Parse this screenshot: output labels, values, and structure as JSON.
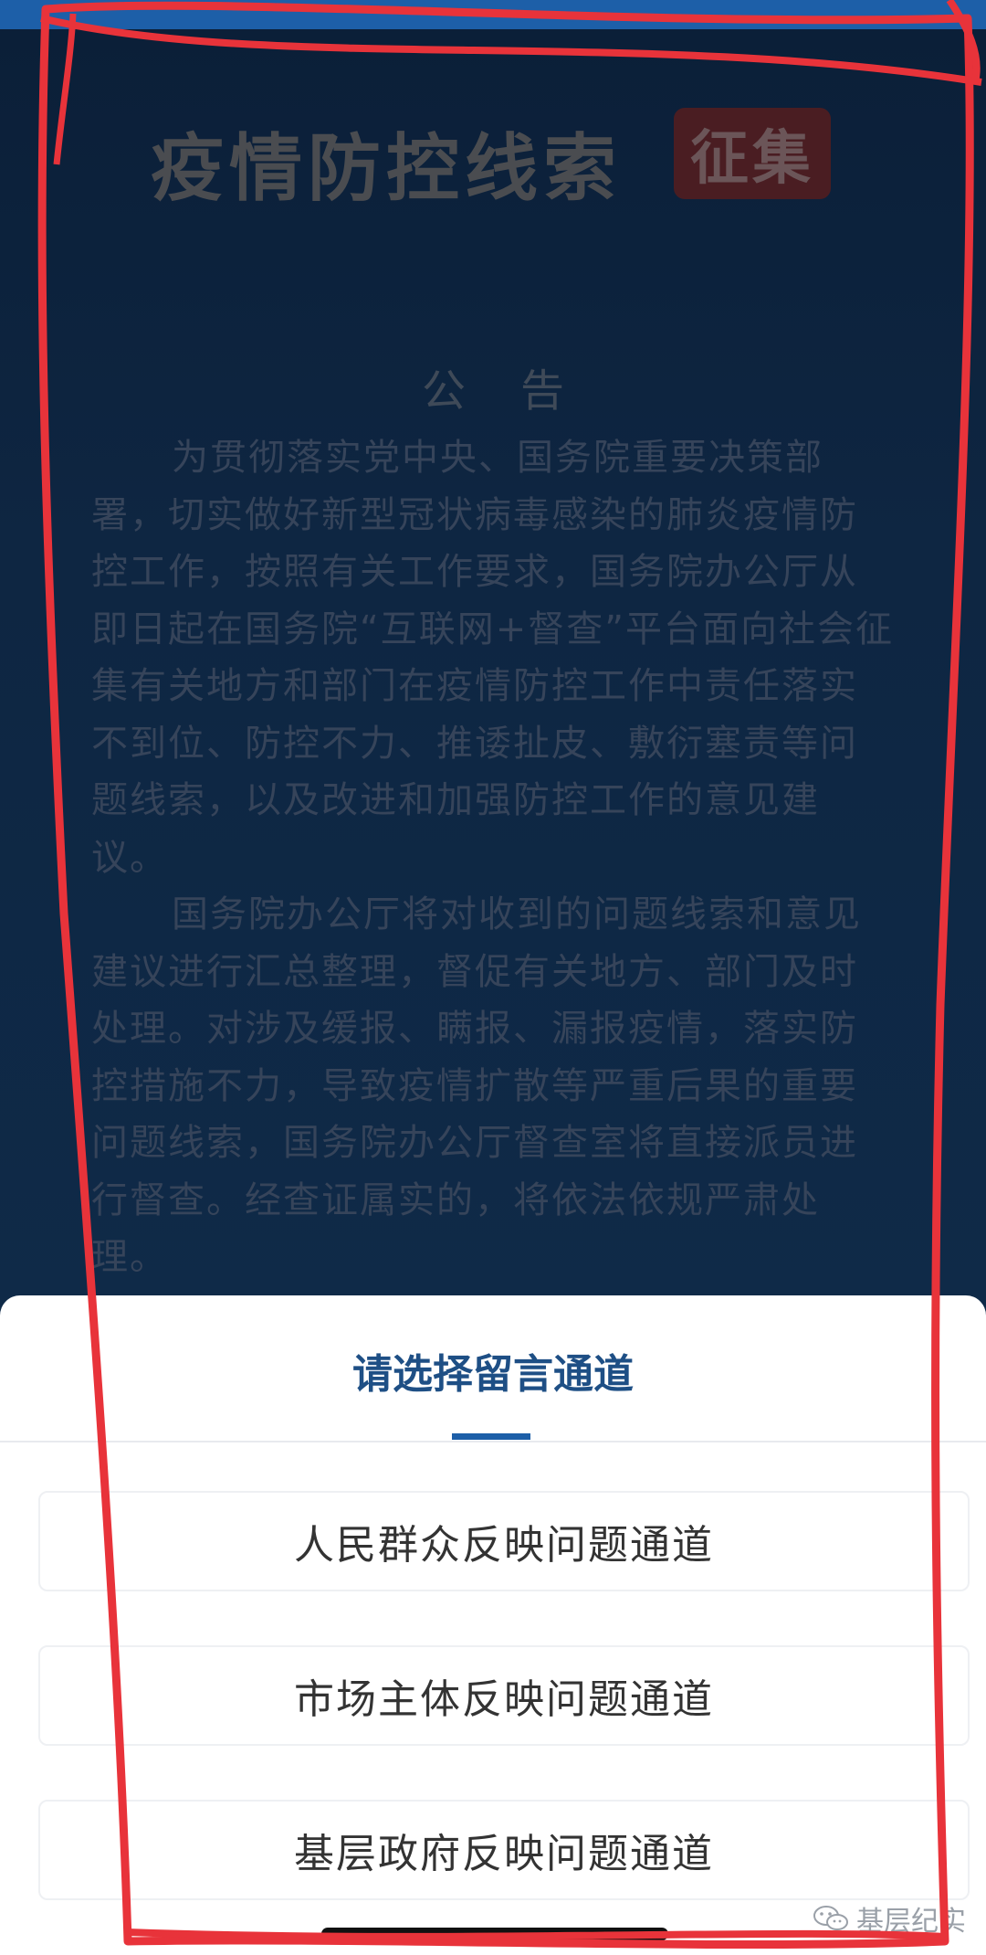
{
  "banner": {
    "title": "疫情防控线索",
    "tag": "征集"
  },
  "notice": {
    "title": "公告",
    "paragraphs": [
      "为贯彻落实党中央、国务院重要决策部署，切实做好新型冠状病毒感染的肺炎疫情防控工作，按照有关工作要求，国务院办公厅从即日起在国务院“互联网+督查”平台面向社会征集有关地方和部门在疫情防控工作中责任落实不到位、防控不力、推诿扯皮、敷衍塞责等问题线索，以及改进和加强防控工作的意见建议。",
      "国务院办公厅将对收到的问题线索和意见建议进行汇总整理，督促有关地方、部门及时处理。对涉及缓报、瞒报、漏报疫情，落实防控措施不力，导致疫情扩散等严重后果的重要问题线索，国务院办公厅督查室将直接派员进行督查。经查证属实的，将依法依规严肃处理。"
    ]
  },
  "sheet": {
    "title": "请选择留言通道",
    "options": [
      "人民群众反映问题通道",
      "市场主体反映问题通道",
      "基层政府反映问题通道"
    ]
  },
  "watermark": {
    "text": "基层纪实",
    "icon": "wechat-icon"
  },
  "colors": {
    "accent": "#1d5fa8",
    "annotation": "#e8333a",
    "background": "#0d2139"
  }
}
